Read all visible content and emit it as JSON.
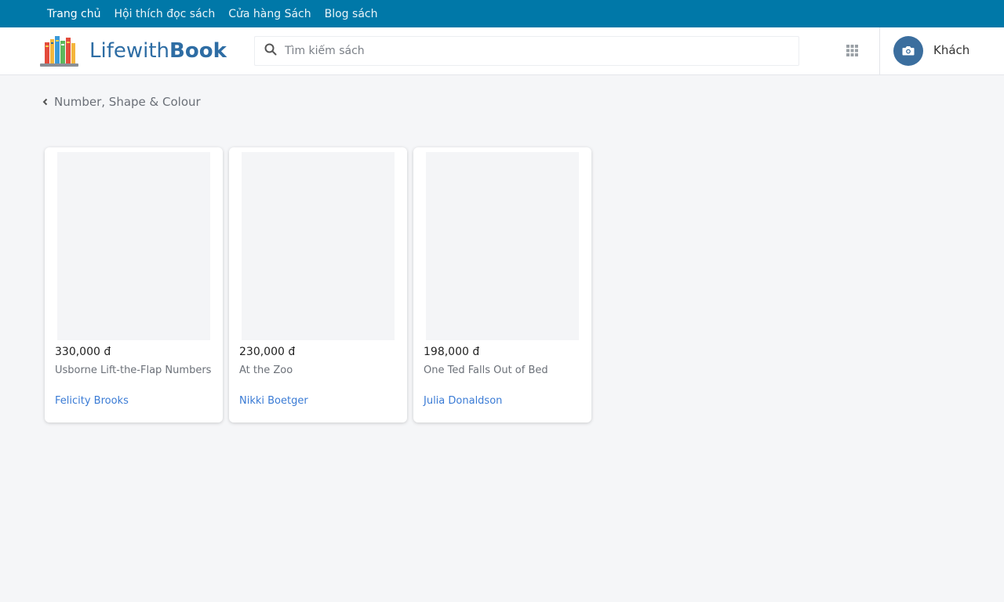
{
  "top_nav": {
    "items": [
      {
        "label": "Trang chủ"
      },
      {
        "label": "Hội thích đọc sách"
      },
      {
        "label": "Cửa hàng Sách"
      },
      {
        "label": "Blog sách"
      }
    ]
  },
  "header": {
    "logo_text_light": "Lifewith",
    "logo_text_bold": "Book",
    "search_placeholder": "Tìm kiếm sách",
    "user_name": "Khách"
  },
  "icons": {
    "search": "search-icon",
    "apps": "apps-grid-icon",
    "avatar": "camera-icon",
    "breadcrumb": "chevron-left-icon"
  },
  "breadcrumb": {
    "label": "Number, Shape & Colour"
  },
  "books": [
    {
      "price": "330,000 đ",
      "title": "Usborne Lift-the-Flap Numbers",
      "author": "Felicity Brooks"
    },
    {
      "price": "230,000 đ",
      "title": "At the Zoo",
      "author": "Nikki Boetger"
    },
    {
      "price": "198,000 đ",
      "title": "One Ted Falls Out of Bed",
      "author": "Julia Donaldson"
    }
  ],
  "colors": {
    "top_nav_bg": "#0078a8",
    "brand": "#2e6da4",
    "author_link": "#3a7bd5",
    "avatar_bg": "#3b6e9e"
  }
}
